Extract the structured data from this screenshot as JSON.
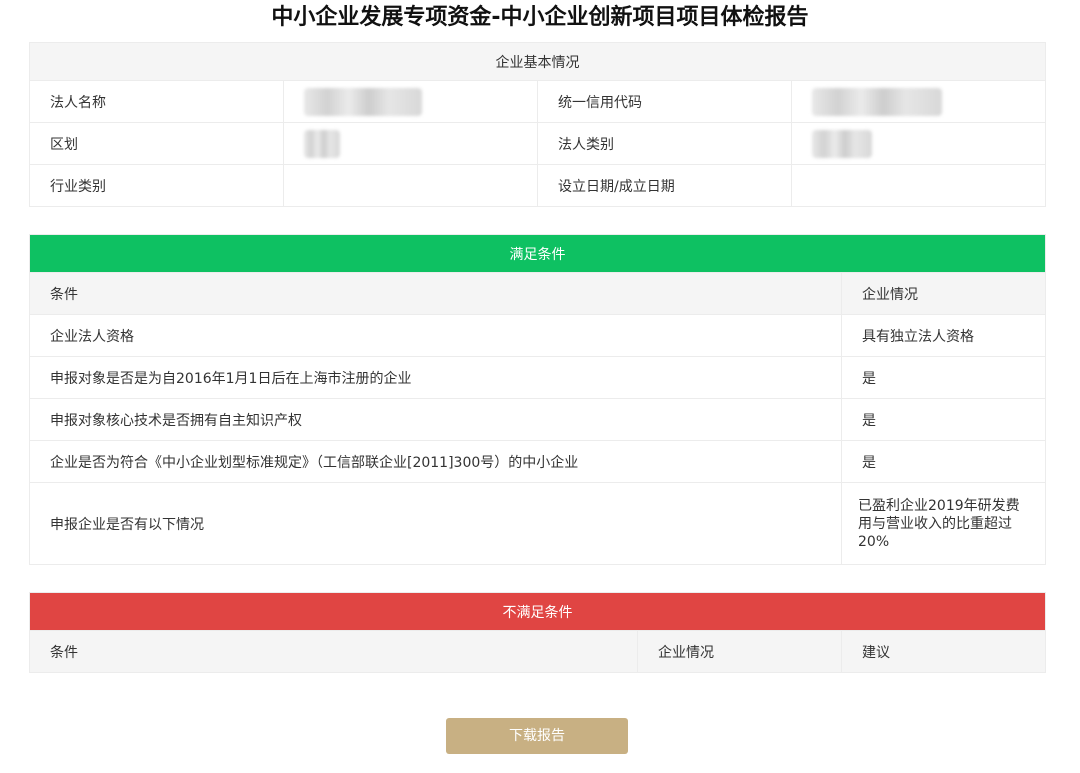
{
  "page": {
    "title": "中小企业发展专项资金-中小企业创新项目项目体检报告"
  },
  "basic_info": {
    "header": "企业基本情况",
    "rows": [
      {
        "label1": "法人名称",
        "value1": "",
        "label2": "统一信用代码",
        "value2": ""
      },
      {
        "label1": "区划",
        "value1": "",
        "label2": "法人类别",
        "value2": ""
      },
      {
        "label1": "行业类别",
        "value1": "",
        "label2": "设立日期/成立日期",
        "value2": ""
      }
    ]
  },
  "met": {
    "header": "满足条件",
    "col_condition": "条件",
    "col_status": "企业情况",
    "rows": [
      {
        "condition": "企业法人资格",
        "status": "具有独立法人资格"
      },
      {
        "condition": "申报对象是否是为自2016年1月1日后在上海市注册的企业",
        "status": "是"
      },
      {
        "condition": "申报对象核心技术是否拥有自主知识产权",
        "status": "是"
      },
      {
        "condition": "企业是否为符合《中小企业划型标准规定》（工信部联企业[2011]300号）的中小企业",
        "status": "是"
      },
      {
        "condition": "申报企业是否有以下情况",
        "status": "已盈利企业2019年研发费用与营业收入的比重超过20%"
      }
    ]
  },
  "unmet": {
    "header": "不满足条件",
    "col_condition": "条件",
    "col_status": "企业情况",
    "col_suggestion": "建议"
  },
  "actions": {
    "download_label": "下载报告"
  },
  "colors": {
    "met_band": "#0ec162",
    "unmet_band": "#e04543",
    "button": "#c8b083"
  }
}
